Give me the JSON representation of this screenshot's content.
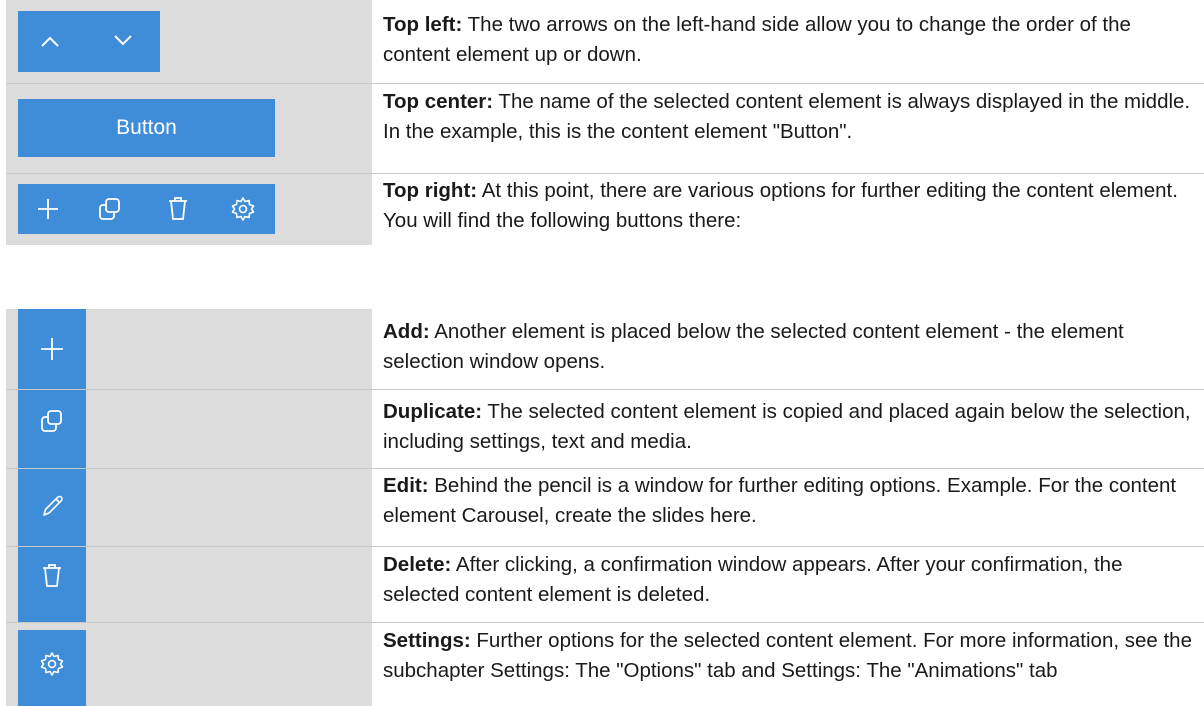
{
  "top_table": [
    {
      "bold": "Top left:",
      "text": " The two arrows on the left-hand side allow you to change the order of the content element up or down."
    },
    {
      "bold": "Top center:",
      "text": " The name of the selected content element is always displayed in the middle. In the example, this is the content element \"Button\".",
      "button_label": "Button"
    },
    {
      "bold": "Top right:",
      "text": " At this point, there are various options for further editing the content element. You will find the following buttons there:"
    }
  ],
  "buttons_table": [
    {
      "bold": "Add:",
      "text": " Another element is placed below the selected content element - the element selection window opens.",
      "icon": "plus-icon"
    },
    {
      "bold": "Duplicate:",
      "text": " The selected content element is copied and placed again below the selection, including settings, text and media.",
      "icon": "duplicate-icon"
    },
    {
      "bold": "Edit:",
      "text": " Behind the pencil is a window for further editing options. Example. For the content element Carousel, create the slides here.",
      "icon": "pencil-icon"
    },
    {
      "bold": "Delete:",
      "text": " After clicking, a confirmation window appears. After your confirmation, the selected content element is deleted.",
      "icon": "trash-icon"
    },
    {
      "bold": "Settings:",
      "text": " Further options for the selected content element. For more information, see the subchapter Settings: The \"Options\" tab and Settings: The \"Animations\" tab",
      "icon": "gear-icon"
    }
  ],
  "colors": {
    "accent": "#3f8dd8",
    "cell_bg": "#dcdcdc"
  }
}
